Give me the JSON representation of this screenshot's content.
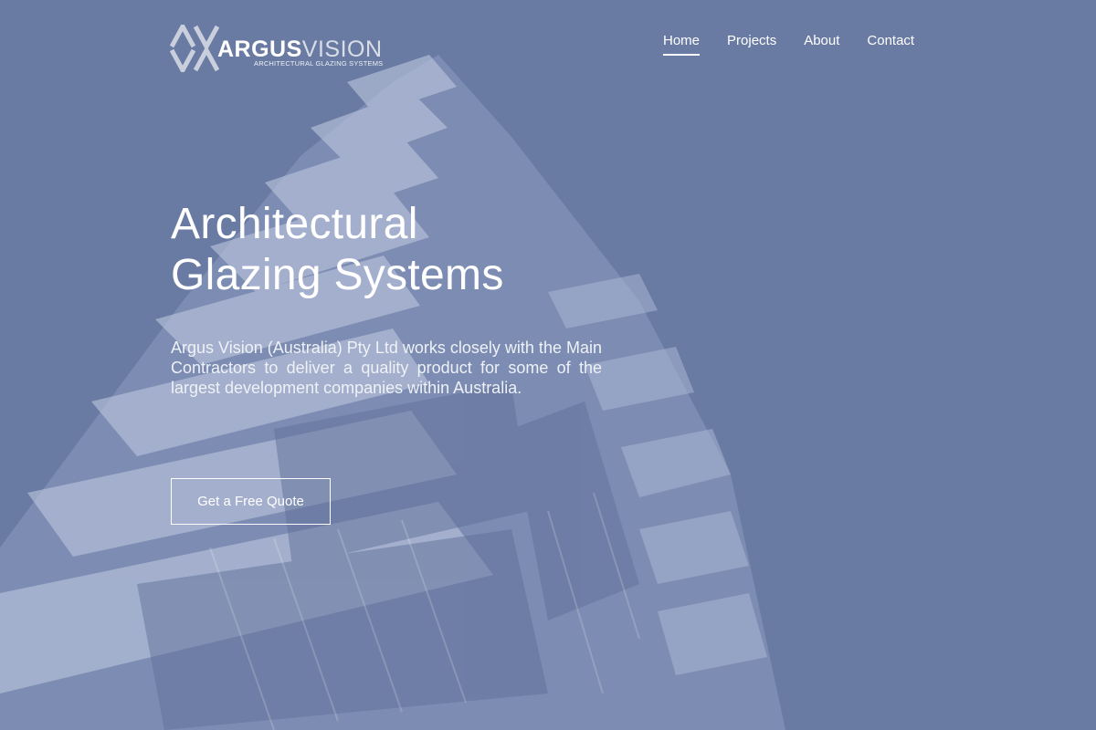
{
  "brand": {
    "name_bold": "ARGUS",
    "name_light": "VISION",
    "tagline": "ARCHITECTURAL GLAZING SYSTEMS"
  },
  "nav": {
    "items": [
      {
        "label": "Home",
        "active": true
      },
      {
        "label": "Projects",
        "active": false
      },
      {
        "label": "About",
        "active": false
      },
      {
        "label": "Contact",
        "active": false
      }
    ]
  },
  "hero": {
    "title_line1": "Architectural",
    "title_line2": "Glazing Systems",
    "description": "Argus Vision (Australia) Pty Ltd works closely with the Main Contractors to deliver a quality product for some of the largest development companies within Australia.",
    "cta_label": "Get a Free Quote"
  },
  "colors": {
    "overlay": "#6a7ba3",
    "text": "#ffffff"
  }
}
